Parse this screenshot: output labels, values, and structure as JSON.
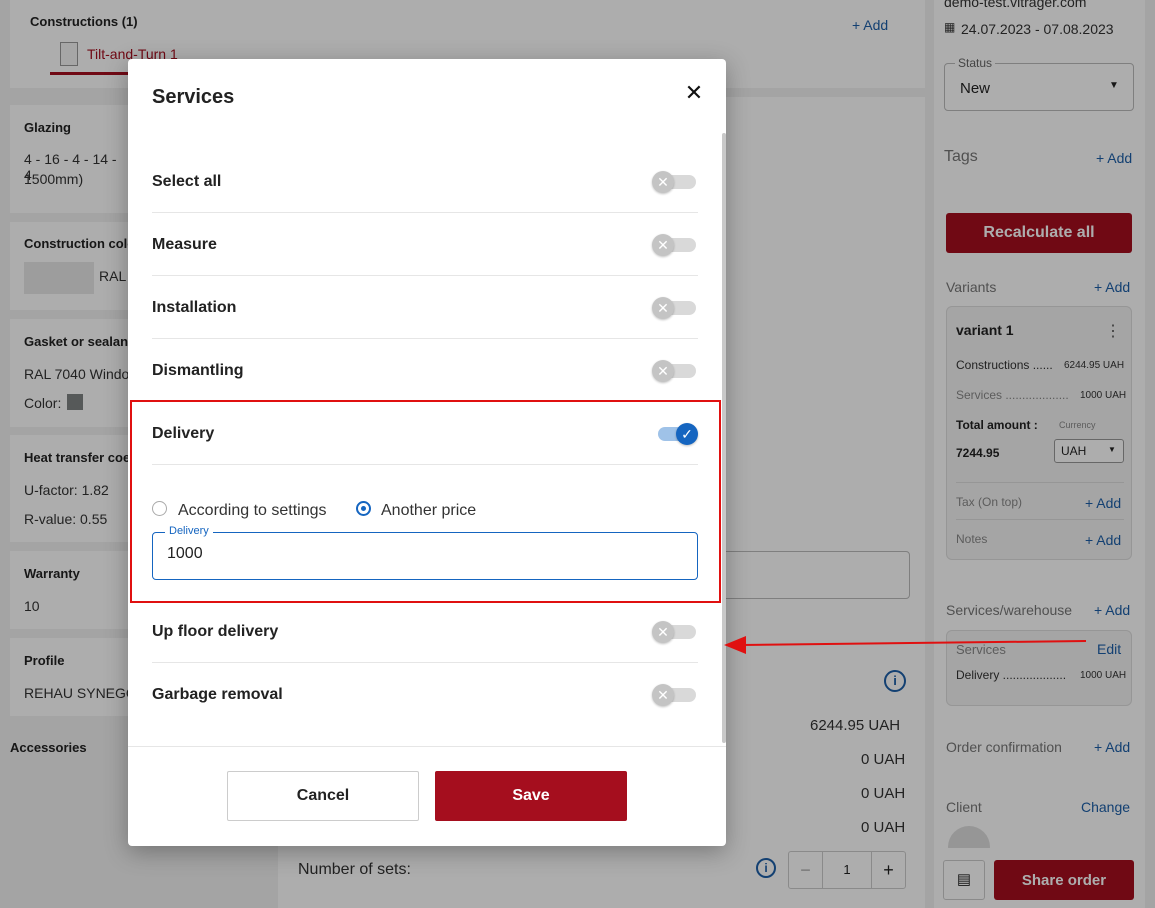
{
  "background": {
    "constructions_title": "Constructions (1)",
    "add_label": "+ Add",
    "tab_label": "Tilt-and-Turn 1",
    "glazing": {
      "title": "Glazing",
      "line1": "4 - 16 - 4 - 14 - 4",
      "line2": "1500mm)"
    },
    "construction_color": {
      "title": "Construction colo",
      "value": "RAL"
    },
    "gasket": {
      "title": "Gasket or sealant",
      "value": "RAL 7040 Windo",
      "color_label": "Color:"
    },
    "heat": {
      "title": "Heat transfer coef",
      "u": "U-factor:  1.82",
      "r": "R-value:  0.55"
    },
    "warranty": {
      "title": "Warranty",
      "value": "10"
    },
    "profile": {
      "title": "Profile",
      "value": "REHAU SYNEGO"
    },
    "accessories": "Accessories",
    "totals": [
      "6244.95 UAH",
      "0 UAH",
      "0 UAH",
      "0 UAH"
    ],
    "number_of_sets_label": "Number of sets:",
    "sets_value": "1",
    "minus": "−",
    "plus": "+"
  },
  "sidebar": {
    "domain": "demo-test.vitrager.com",
    "dates": "24.07.2023 - 07.08.2023",
    "status_label": "Status",
    "status_value": "New",
    "tags": "Tags",
    "add": "+ Add",
    "recalculate": "Recalculate all",
    "variants": "Variants",
    "variant_name": "variant 1",
    "constructions_row": "Constructions ......",
    "constructions_value": "6244.95 UAH",
    "services_row": "Services ...................",
    "services_value": "1000 UAH",
    "total_amount": "Total amount :",
    "currency_label": "Currency",
    "total_value": "7244.95",
    "currency_value": "UAH",
    "tax": "Tax (On top)",
    "notes": "Notes",
    "services_warehouse": "Services/warehouse",
    "sw_services": "Services",
    "sw_edit": "Edit",
    "sw_delivery": "Delivery ...................",
    "sw_delivery_value": "1000 UAH",
    "order_confirmation": "Order confirmation",
    "client": "Client",
    "change": "Change",
    "share_order": "Share order"
  },
  "modal": {
    "title": "Services",
    "close": "✕",
    "rows": [
      {
        "label": "Select all",
        "on": false
      },
      {
        "label": "Measure",
        "on": false
      },
      {
        "label": "Installation",
        "on": false
      },
      {
        "label": "Dismantling",
        "on": false
      },
      {
        "label": "Delivery",
        "on": true
      },
      {
        "label": "Up floor delivery",
        "on": false
      },
      {
        "label": "Garbage removal",
        "on": false
      }
    ],
    "radio_settings": "According to settings",
    "radio_another": "Another price",
    "field_label": "Delivery",
    "field_value": "1000",
    "cancel": "Cancel",
    "save": "Save"
  },
  "colors": {
    "accent": "#a50e1e",
    "blue": "#1565c0",
    "annotation": "#e01010"
  }
}
